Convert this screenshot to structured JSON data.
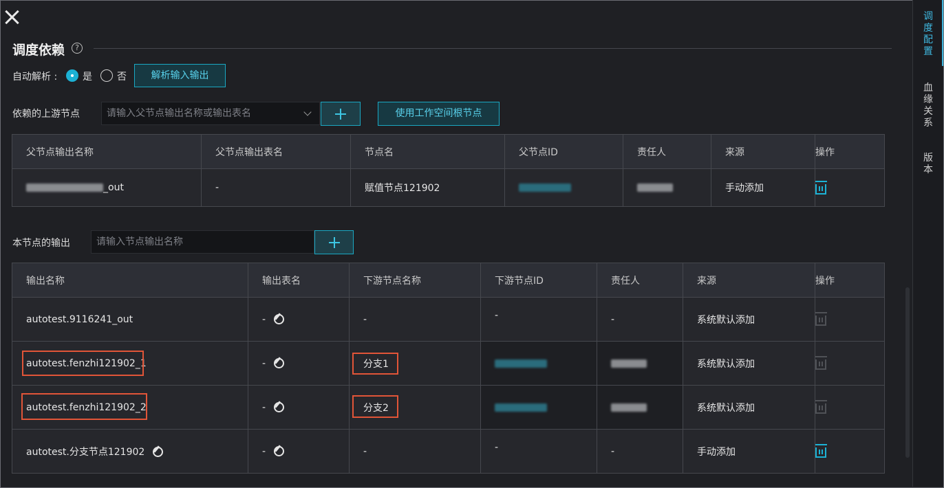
{
  "section": {
    "title": "调度依赖"
  },
  "auto_parse": {
    "label": "自动解析 :",
    "yes": "是",
    "no": "否",
    "parse_button": "解析输入输出"
  },
  "upstream": {
    "label": "依赖的上游节点",
    "placeholder": "请输入父节点输出名称或输出表名",
    "root_button": "使用工作空间根节点",
    "headers": [
      "父节点输出名称",
      "父节点输出表名",
      "节点名",
      "父节点ID",
      "责任人",
      "来源",
      "操作"
    ],
    "row": {
      "output_suffix": "_out",
      "table_name": "-",
      "node_name": "赋值节点121902",
      "source": "手动添加"
    }
  },
  "outputs": {
    "label": "本节点的输出",
    "placeholder": "请输入节点输出名称",
    "headers": [
      "输出名称",
      "输出表名",
      "下游节点名称",
      "下游节点ID",
      "责任人",
      "来源",
      "操作"
    ],
    "rows": [
      {
        "name": "autotest.9116241_out",
        "table": "-",
        "downstream": "-",
        "id": "-",
        "owner": "-",
        "source": "系统默认添加"
      },
      {
        "name": "autotest.fenzhi121902_1",
        "table": "-",
        "downstream": "分支1",
        "source": "系统默认添加"
      },
      {
        "name": "autotest.fenzhi121902_2",
        "table": "-",
        "downstream": "分支2",
        "source": "系统默认添加"
      },
      {
        "name": "autotest.分支节点121902",
        "table": "-",
        "downstream": "-",
        "id": "-",
        "owner": "-",
        "source": "手动添加"
      }
    ]
  },
  "sidebar": {
    "tabs": [
      "调度配置",
      "血缘关系",
      "版本"
    ]
  },
  "colors": {
    "accent": "#1cb1d4",
    "highlight": "#e25538",
    "background": "#1f2024"
  }
}
